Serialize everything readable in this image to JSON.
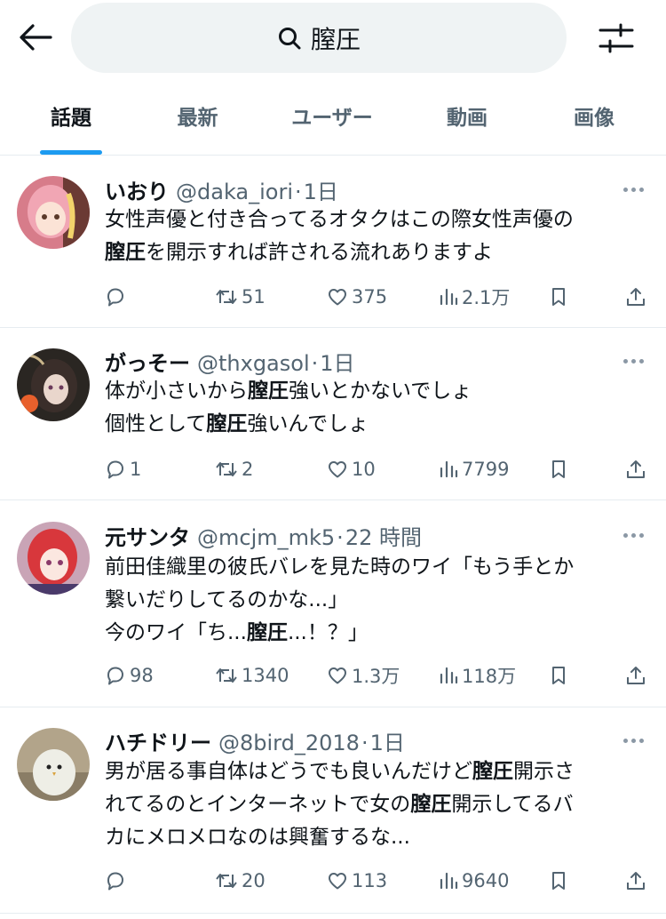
{
  "search": {
    "query": "膣圧"
  },
  "tabs": [
    {
      "label": "話題",
      "active": true
    },
    {
      "label": "最新"
    },
    {
      "label": "ユーザー"
    },
    {
      "label": "動画"
    },
    {
      "label": "画像"
    }
  ],
  "colors": {
    "accent": "#1d9bf0",
    "text": "#0f1419",
    "secondary": "#536471",
    "pill": "#eff3f4"
  },
  "posts": [
    {
      "name": "いおり",
      "handle": "@daka_iori",
      "time": "1日",
      "lines": [
        [
          {
            "t": "女性声優と付き合ってるオタクはこの際女性声優の"
          }
        ],
        [
          {
            "t": "膣圧",
            "b": true
          },
          {
            "t": "を開示すれば許される流れありますよ"
          }
        ]
      ],
      "stats": {
        "replies": "",
        "reposts": "51",
        "likes": "375",
        "views": "2.1万"
      }
    },
    {
      "name": "がっそー",
      "handle": "@thxgasol",
      "time": "1日",
      "lines": [
        [
          {
            "t": "体が小さいから"
          },
          {
            "t": "膣圧",
            "b": true
          },
          {
            "t": "強いとかないでしょ"
          }
        ],
        [
          {
            "t": "個性として"
          },
          {
            "t": "膣圧",
            "b": true
          },
          {
            "t": "強いんでしょ"
          }
        ]
      ],
      "stats": {
        "replies": "1",
        "reposts": "2",
        "likes": "10",
        "views": "7799"
      }
    },
    {
      "name": "元サンタ",
      "handle": "@mcjm_mk5",
      "time": "22 時間",
      "lines": [
        [
          {
            "t": "前田佳織里の彼氏バレを見た時のワイ「もう手とか"
          }
        ],
        [
          {
            "t": "繋いだりしてるのかな...」"
          }
        ],
        [
          {
            "t": "今のワイ「ち..."
          },
          {
            "t": "膣圧",
            "b": true
          },
          {
            "t": "...！？」"
          }
        ]
      ],
      "stats": {
        "replies": "98",
        "reposts": "1340",
        "likes": "1.3万",
        "views": "118万"
      }
    },
    {
      "name": "ハチドリー",
      "handle": "@8bird_2018",
      "time": "1日",
      "lines": [
        [
          {
            "t": "男が居る事自体はどうでも良いんだけど"
          },
          {
            "t": "膣圧",
            "b": true
          },
          {
            "t": "開示さ"
          }
        ],
        [
          {
            "t": "れてるのとインターネットで女の"
          },
          {
            "t": "膣圧",
            "b": true
          },
          {
            "t": "開示してるバ"
          }
        ],
        [
          {
            "t": "カにメロメロなのは興奮するな..."
          }
        ]
      ],
      "stats": {
        "replies": "",
        "reposts": "20",
        "likes": "113",
        "views": "9640"
      }
    }
  ]
}
